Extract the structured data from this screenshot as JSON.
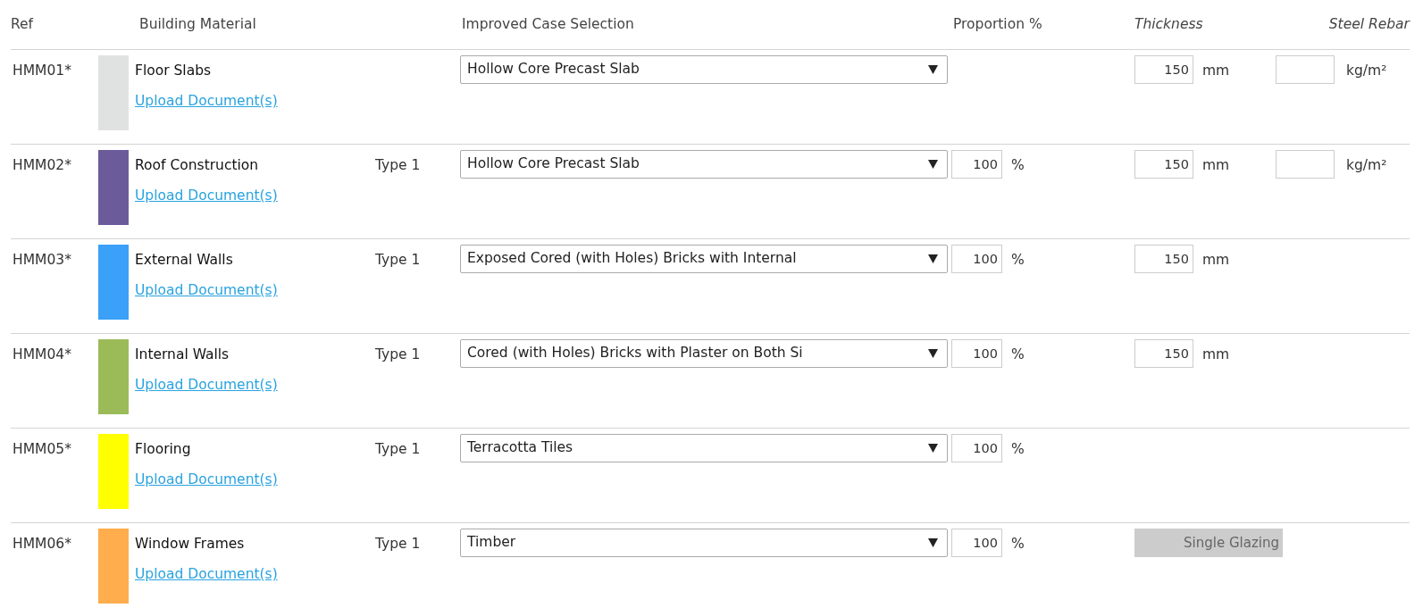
{
  "columns": [
    {
      "label": "Ref",
      "italic": false
    },
    {
      "label": "Building Material",
      "italic": false
    },
    {
      "label": "Improved Case Selection",
      "italic": false
    },
    {
      "label": "Proportion %",
      "italic": false
    },
    {
      "label": "Thickness",
      "italic": true
    },
    {
      "label": "Steel Rebar",
      "italic": true
    }
  ],
  "rows": [
    {
      "ref": "HMM01*",
      "color": "#e0e2e1",
      "material": "Floor Slabs",
      "link": "Upload Document(s)",
      "selection": "Hollow Core Precast Slab",
      "thickness": {
        "value": "150",
        "unit": "mm"
      },
      "rebar": {
        "unit": "kg/m²"
      }
    },
    {
      "ref": "HMM02*",
      "color": "#6b5b9a",
      "material": "Roof Construction",
      "link": "Upload Document(s)",
      "type": "Type 1",
      "selection": "Hollow Core Precast Slab",
      "proportion": {
        "value": "100",
        "unit": "%"
      },
      "thickness": {
        "value": "150",
        "unit": "mm"
      },
      "rebar": {
        "unit": "kg/m²"
      }
    },
    {
      "ref": "HMM03*",
      "color": "#3aa0f8",
      "material": "External Walls",
      "link": "Upload Document(s)",
      "type": "Type 1",
      "selection": "Exposed Cored (with Holes) Bricks with Internal",
      "proportion": {
        "value": "100",
        "unit": "%"
      },
      "thickness": {
        "value": "150",
        "unit": "mm"
      }
    },
    {
      "ref": "HMM04*",
      "color": "#9bbb59",
      "material": "Internal Walls",
      "link": "Upload Document(s)",
      "type": "Type 1",
      "selection": "Cored (with Holes) Bricks with Plaster on Both Si",
      "proportion": {
        "value": "100",
        "unit": "%"
      },
      "thickness": {
        "value": "150",
        "unit": "mm"
      }
    },
    {
      "ref": "HMM05*",
      "color": "#ffff00",
      "material": "Flooring",
      "link": "Upload Document(s)",
      "type": "Type 1",
      "selection": "Terracotta Tiles",
      "proportion": {
        "value": "100",
        "unit": "%"
      }
    },
    {
      "ref": "HMM06*",
      "color": "#ffad4d",
      "material": "Window Frames",
      "link": "Upload Document(s)",
      "type": "Type 1",
      "selection": "Timber",
      "proportion": {
        "value": "100",
        "unit": "%"
      },
      "glazing": {
        "label": "Single Glazing",
        "disabled": true
      }
    }
  ]
}
